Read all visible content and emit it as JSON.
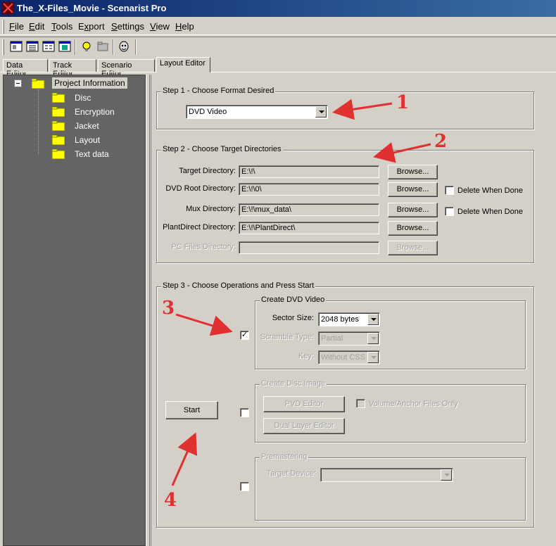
{
  "window": {
    "title": "The_X-Files_Movie - Scenarist Pro"
  },
  "menu": [
    "File",
    "Edit",
    "Tools",
    "Export",
    "Settings",
    "View",
    "Help"
  ],
  "menu_underline": [
    "F",
    "E",
    "T",
    "x",
    "S",
    "V",
    "H"
  ],
  "tabs": [
    "Data Editor",
    "Track Editor",
    "Scenario Editor",
    "Layout Editor"
  ],
  "tree": {
    "root": "Project Information",
    "children": [
      "Disc",
      "Encryption",
      "Jacket",
      "Layout",
      "Text data"
    ]
  },
  "step1": {
    "title": "Step 1 - Choose Format Desired",
    "format": "DVD Video"
  },
  "step2": {
    "title": "Step 2 - Choose Target Directories",
    "rows": [
      {
        "label": "Target Directory:",
        "value": "E:\\!\\",
        "button": "Browse..."
      },
      {
        "label": "DVD Root Directory:",
        "value": "E:\\!\\0\\",
        "button": "Browse...",
        "delete": "Delete When Done"
      },
      {
        "label": "Mux Directory:",
        "value": "E:\\!\\mux_data\\",
        "button": "Browse...",
        "delete": "Delete When Done"
      },
      {
        "label": "PlantDirect Directory:",
        "value": "E:\\!\\PlantDirect\\",
        "button": "Browse..."
      },
      {
        "label": "PC Files Directory:",
        "value": "",
        "button": "Browse..."
      }
    ]
  },
  "step3": {
    "title": "Step 3 - Choose Operations and Press Start",
    "start": "Start",
    "create_dvd": {
      "title": "Create DVD Video",
      "sector_label": "Sector Size:",
      "sector_value": "2048 bytes",
      "scramble_label": "Scramble Type:",
      "scramble_value": "Partial",
      "key_label": "Key:",
      "key_value": "Without CSS"
    },
    "disc_image": {
      "title": "Create Disc Image",
      "pvd": "PVD Editor",
      "dual": "Dual Layer Editor",
      "volume": "Volume/Anchor Files Only"
    },
    "premastering": {
      "title": "Premastering",
      "device_label": "Target Device:"
    }
  },
  "annotations": [
    "1",
    "2",
    "3",
    "4"
  ],
  "colors": {
    "title_bar": "#0a246a",
    "annotation": "#e03030",
    "tree_bg": "#646464"
  }
}
